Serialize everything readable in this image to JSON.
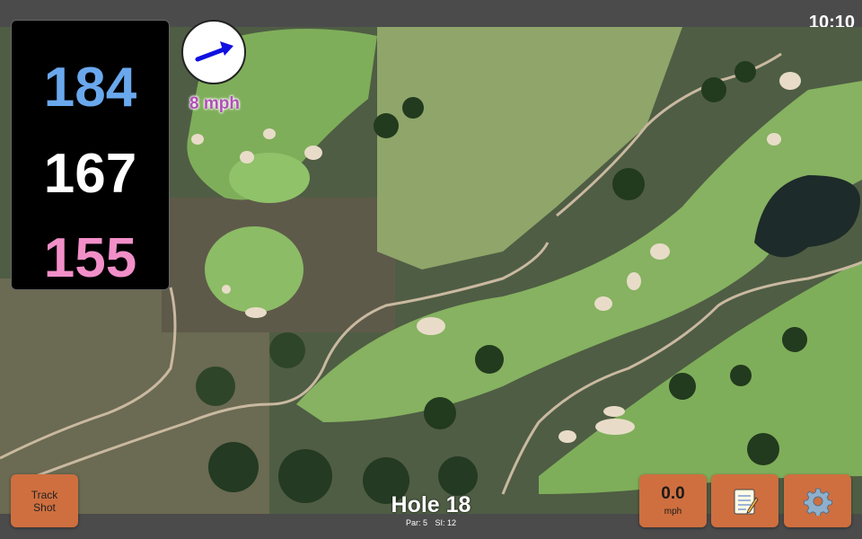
{
  "status": {
    "time": "10:10"
  },
  "distances": {
    "back": "184",
    "middle": "167",
    "front": "155"
  },
  "wind": {
    "speed_label": "8 mph",
    "icon": "wind-arrow-icon"
  },
  "hole": {
    "title": "Hole 18",
    "par": "Par: 5",
    "si": "SI: 12"
  },
  "buttons": {
    "track_line1": "Track",
    "track_line2": "Shot",
    "speed_value": "0.0",
    "speed_unit": "mph",
    "notes_icon": "notepad-icon",
    "settings_icon": "gear-icon"
  },
  "colors": {
    "back": "#6aa8ee",
    "middle": "#ffffff",
    "front": "#f28fc8",
    "button": "#cf6f3f",
    "wind_text": "#b24fb7"
  }
}
